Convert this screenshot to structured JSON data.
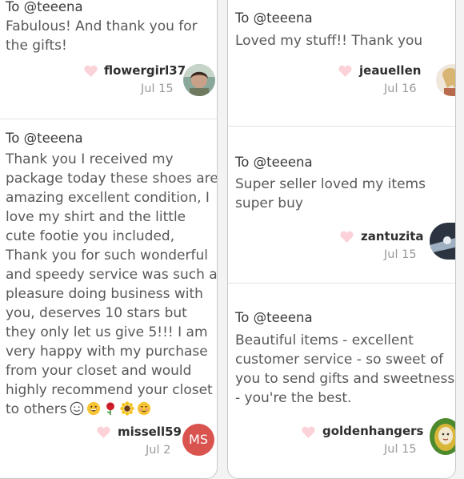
{
  "reviews": [
    {
      "to": "To @teeena",
      "message": "Fabulous! And thank you for the gifts!",
      "username": "flowergirl37",
      "date": "Jul 15"
    },
    {
      "to": "To @teeena",
      "message": "Thank you I received my package today these shoes are amazing excellent condition, I love my shirt and the little cute footie you included, Thank you for such wonderful and speedy service was such a pleasure doing business with you, deserves 10 stars but they only let us give 5!!! I am very happy with my purchase from your closet and would highly recommend your closet to others",
      "emojis": [
        "smile-emoji",
        "grin-emoji",
        "rose-emoji",
        "sunflower-emoji",
        "blush-emoji"
      ],
      "username": "missell59",
      "date": "Jul 2",
      "avatar_initials": "MS"
    },
    {
      "to": "To @teeena",
      "message": "Loved my stuff!! Thank you",
      "username": "jeauellen",
      "date": "Jul 16"
    },
    {
      "to": "To @teeena",
      "message": "Super seller loved my items super buy",
      "username": "zantuzita",
      "date": "Jul 15"
    },
    {
      "to": "To @teeena",
      "message": "Beautiful items - excellent customer service - so sweet of you to send gifts and sweetness - you're the best.",
      "username": "goldenhangers",
      "date": "Jul 15"
    }
  ],
  "colors": {
    "heart": "#fbd2d7",
    "avatar_ms": "#d9534f"
  }
}
